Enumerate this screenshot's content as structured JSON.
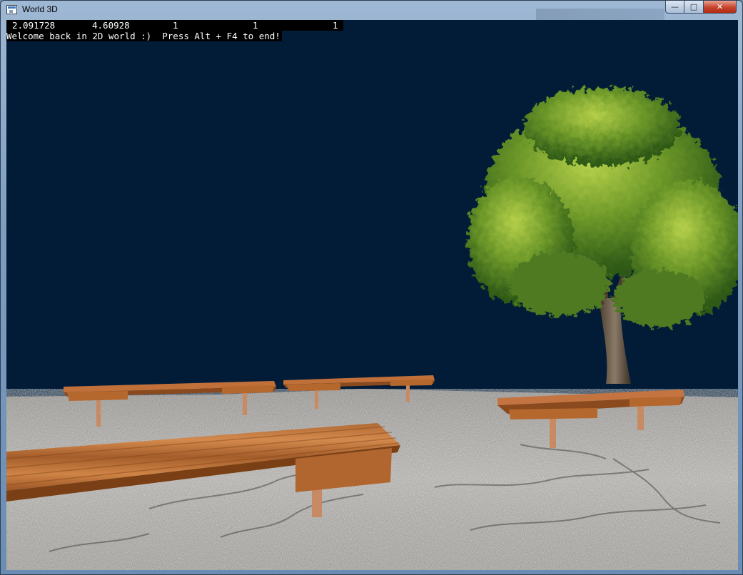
{
  "window": {
    "title": "World 3D",
    "icon": "app-window-icon",
    "buttons": {
      "minimize": "—",
      "maximize": "□",
      "close": "✕"
    }
  },
  "hud": {
    "row1": [
      "2.091728",
      "4.60928",
      "1",
      "1",
      "1"
    ],
    "message": "Welcome back in 2D world :)  Press Alt + F4 to end!"
  },
  "scene": {
    "sky_color": "#021c38",
    "objects": [
      "ground-plane",
      "tree",
      "bench-front",
      "bench-back-left",
      "bench-back-middle",
      "bench-right"
    ]
  }
}
